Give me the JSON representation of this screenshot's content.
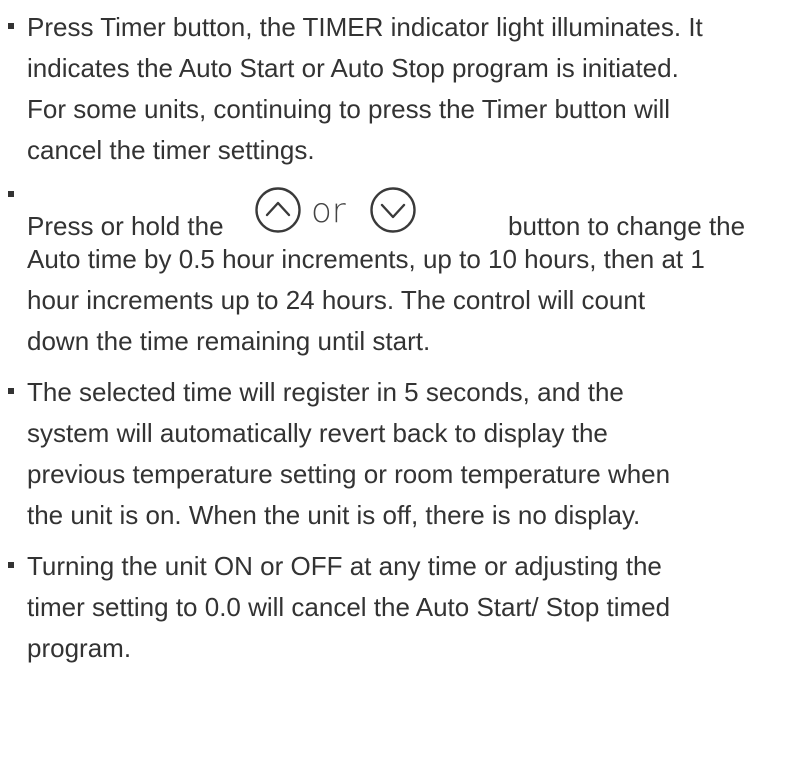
{
  "items": [
    {
      "lines": [
        "Press Timer button, the TIMER indicator light illuminates. It",
        "indicates the Auto Start or Auto Stop program is initiated.",
        "For some units, continuing to press the Timer button will",
        "cancel the timer settings."
      ]
    },
    {
      "line_before": "Press or hold the",
      "or_text": "or",
      "line_after": "button to change the",
      "up_icon": "chevron-up-circle-icon",
      "down_icon": "chevron-down-circle-icon",
      "lines": [
        "Auto time by 0.5 hour increments, up to 10 hours, then at 1",
        "hour increments up to 24 hours. The control will count",
        "down the time remaining until start."
      ]
    },
    {
      "lines": [
        "The selected time will register in 5 seconds, and the",
        "system will automatically revert back to display the",
        "previous temperature setting or room temperature when",
        "the unit is on. When the unit is off, there is no display."
      ]
    },
    {
      "lines": [
        "Turning the unit ON or OFF at any time or adjusting the",
        "timer setting to 0.0 will cancel the Auto Start/ Stop timed",
        "program."
      ]
    }
  ]
}
